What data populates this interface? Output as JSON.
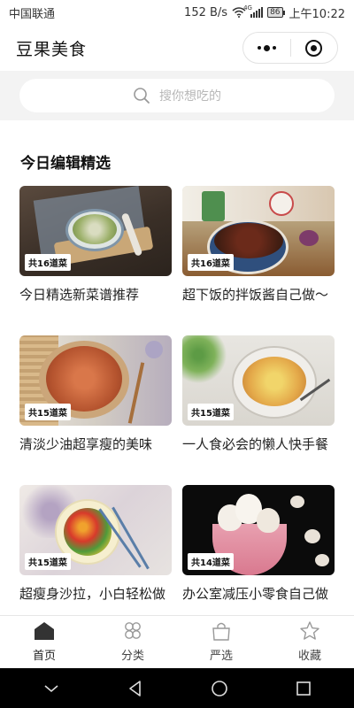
{
  "status_bar": {
    "carrier": "中国联通",
    "speed": "152 B/s",
    "network": "4G",
    "battery": "86",
    "time": "上午10:22"
  },
  "header": {
    "title": "豆果美食",
    "more_icon": "more-dots-icon",
    "close_icon": "target-close-icon"
  },
  "search": {
    "placeholder": "搜你想吃的",
    "icon": "search-icon"
  },
  "section": {
    "title": "今日编辑精选"
  },
  "cards": [
    {
      "badge": "共16道菜",
      "title": "今日精选新菜谱推荐"
    },
    {
      "badge": "共16道菜",
      "title": "超下饭的拌饭酱自己做～"
    },
    {
      "badge": "共15道菜",
      "title": "清淡少油超享瘦的美味"
    },
    {
      "badge": "共15道菜",
      "title": "一人食必会的懒人快手餐"
    },
    {
      "badge": "共15道菜",
      "title": "超瘦身沙拉，小白轻松做"
    },
    {
      "badge": "共14道菜",
      "title": "办公室减压小零食自己做"
    }
  ],
  "tab_bar": {
    "tabs": [
      {
        "label": "首页",
        "icon": "home-icon",
        "active": true
      },
      {
        "label": "分类",
        "icon": "category-icon",
        "active": false
      },
      {
        "label": "严选",
        "icon": "shopping-bag-icon",
        "active": false
      },
      {
        "label": "收藏",
        "icon": "star-icon",
        "active": false
      }
    ]
  },
  "nav_bar": {
    "icons": [
      "chevron-down-icon",
      "back-triangle-icon",
      "home-circle-icon",
      "recents-square-icon"
    ]
  },
  "colors": {
    "background": "#ffffff",
    "search_band": "#f3f3f3",
    "placeholder": "#b8b8b8",
    "nav_bar": "#000000"
  }
}
